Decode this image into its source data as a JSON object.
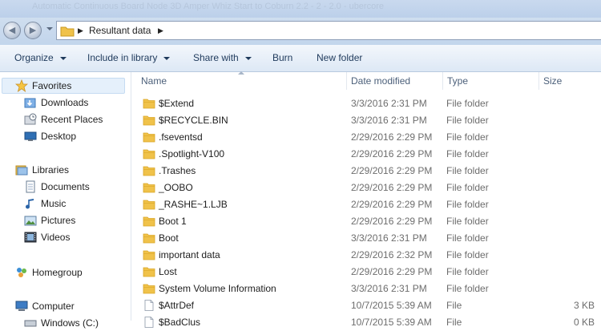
{
  "window": {
    "title": "Automatic Continuous Board Node 3D Amper Whiz Start to Coburn 2.2 - 2 - 2.0 - ubercore"
  },
  "address": {
    "path": [
      "Resultant data"
    ]
  },
  "toolbar": {
    "organize": "Organize",
    "include_in_library": "Include in library",
    "share_with": "Share with",
    "burn": "Burn",
    "new_folder": "New folder"
  },
  "sidebar": {
    "favorites": {
      "label": "Favorites",
      "items": [
        "Downloads",
        "Recent Places",
        "Desktop"
      ]
    },
    "libraries": {
      "label": "Libraries",
      "items": [
        "Documents",
        "Music",
        "Pictures",
        "Videos"
      ]
    },
    "homegroup": {
      "label": "Homegroup"
    },
    "computer": {
      "label": "Computer",
      "items": [
        "Windows (C:)"
      ]
    }
  },
  "columns": {
    "name": "Name",
    "date": "Date modified",
    "type": "Type",
    "size": "Size"
  },
  "files": [
    {
      "name": "$Extend",
      "date": "3/3/2016 2:31 PM",
      "type": "File folder",
      "size": "",
      "icon": "folder-icon"
    },
    {
      "name": "$RECYCLE.BIN",
      "date": "3/3/2016 2:31 PM",
      "type": "File folder",
      "size": "",
      "icon": "folder-icon"
    },
    {
      "name": ".fseventsd",
      "date": "2/29/2016 2:29 PM",
      "type": "File folder",
      "size": "",
      "icon": "folder-icon"
    },
    {
      "name": ".Spotlight-V100",
      "date": "2/29/2016 2:29 PM",
      "type": "File folder",
      "size": "",
      "icon": "folder-icon"
    },
    {
      "name": ".Trashes",
      "date": "2/29/2016 2:29 PM",
      "type": "File folder",
      "size": "",
      "icon": "folder-icon"
    },
    {
      "name": "_OOBO",
      "date": "2/29/2016 2:29 PM",
      "type": "File folder",
      "size": "",
      "icon": "folder-icon"
    },
    {
      "name": "_RASHE~1.LJB",
      "date": "2/29/2016 2:29 PM",
      "type": "File folder",
      "size": "",
      "icon": "folder-icon"
    },
    {
      "name": "Boot 1",
      "date": "2/29/2016 2:29 PM",
      "type": "File folder",
      "size": "",
      "icon": "folder-icon"
    },
    {
      "name": "Boot",
      "date": "3/3/2016 2:31 PM",
      "type": "File folder",
      "size": "",
      "icon": "folder-icon"
    },
    {
      "name": "important data",
      "date": "2/29/2016 2:32 PM",
      "type": "File folder",
      "size": "",
      "icon": "folder-icon"
    },
    {
      "name": "Lost",
      "date": "2/29/2016 2:29 PM",
      "type": "File folder",
      "size": "",
      "icon": "folder-icon"
    },
    {
      "name": "System Volume Information",
      "date": "3/3/2016 2:31 PM",
      "type": "File folder",
      "size": "",
      "icon": "folder-icon"
    },
    {
      "name": "$AttrDef",
      "date": "10/7/2015 5:39 AM",
      "type": "File",
      "size": "3 KB",
      "icon": "file-icon"
    },
    {
      "name": "$BadClus",
      "date": "10/7/2015 5:39 AM",
      "type": "File",
      "size": "0 KB",
      "icon": "file-icon"
    }
  ],
  "colors": {
    "folder": "#f0c24a",
    "folder_dark": "#d9a526",
    "accent": "#1e395b",
    "meta_text": "#6d6d6d"
  }
}
